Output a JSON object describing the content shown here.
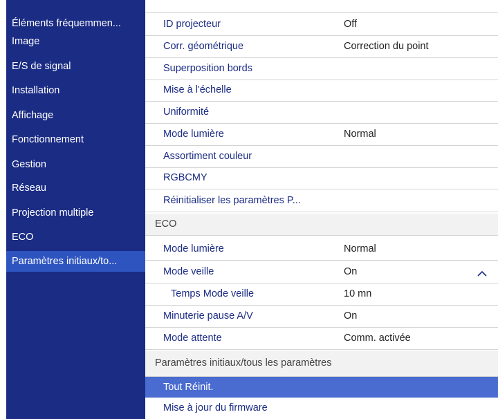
{
  "sidebar": {
    "items": [
      {
        "label": "Éléments fréquemmen..."
      },
      {
        "label": "Image"
      },
      {
        "label": "E/S de signal"
      },
      {
        "label": "Installation"
      },
      {
        "label": "Affichage"
      },
      {
        "label": "Fonctionnement"
      },
      {
        "label": "Gestion"
      },
      {
        "label": "Réseau"
      },
      {
        "label": "Projection multiple"
      },
      {
        "label": "ECO"
      },
      {
        "label": "Paramètres initiaux/to..."
      }
    ]
  },
  "content": {
    "rows": [
      {
        "label": "ID projecteur",
        "value": "Off"
      },
      {
        "label": "Corr. géométrique",
        "value": "Correction du point"
      },
      {
        "label": "Superposition bords",
        "value": ""
      },
      {
        "label": "Mise à l'échelle",
        "value": ""
      },
      {
        "label": "Uniformité",
        "value": ""
      },
      {
        "label": "Mode lumière",
        "value": "Normal"
      },
      {
        "label": "Assortiment couleur",
        "value": ""
      },
      {
        "label": "RGBCMY",
        "value": ""
      },
      {
        "label": "Réinitialiser les paramètres P...",
        "value": ""
      }
    ],
    "eco_header": "ECO",
    "eco_rows": [
      {
        "label": "Mode lumière",
        "value": "Normal"
      },
      {
        "label": "Mode veille",
        "value": "On"
      },
      {
        "label": "Temps Mode veille",
        "value": "10 mn"
      },
      {
        "label": "Minuterie pause A/V",
        "value": "On"
      },
      {
        "label": "Mode attente",
        "value": "Comm. activée"
      }
    ],
    "init_header": "Paramètres initiaux/tous les paramètres",
    "init_rows": [
      {
        "label": "Tout Réinit."
      },
      {
        "label": "Mise à jour du firmware"
      }
    ]
  },
  "icons": {
    "collapse": "chevron-up-icon"
  },
  "colors": {
    "sidebar_bg": "#1b2c84",
    "sidebar_active": "#2e54c0",
    "selected_row": "#4a6bd0",
    "label_text": "#1b2c84"
  }
}
